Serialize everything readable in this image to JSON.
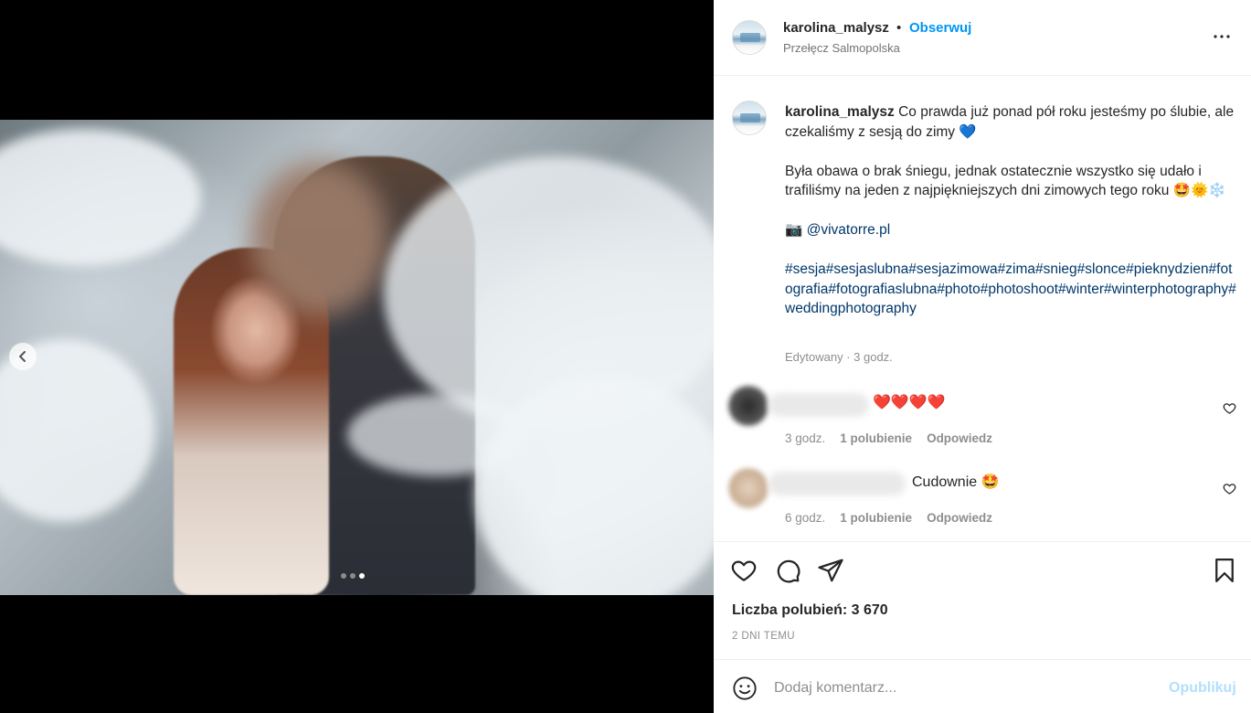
{
  "post": {
    "author": "karolina_malysz",
    "separator": "•",
    "follow_label": "Obserwuj",
    "location": "Przełęcz Salmopolska",
    "more_icon": "more-horizontal-icon"
  },
  "media": {
    "carousel_total": 3,
    "carousel_active": 3
  },
  "caption": {
    "author": "karolina_malysz",
    "line1": "Co prawda już ponad pół roku jesteśmy po ślubie, ale czekaliśmy z sesją do zimy 💙",
    "line2": "Była obawa o brak śniegu, jednak ostatecznie wszystko się udało i trafiliśmy na jeden z najpiękniejszych dni zimowych tego roku 🤩🌞❄️",
    "camera": "📷",
    "mention": "@vivatorre.pl",
    "hashtags": "#sesja#sesjaslubna#sesjazimowa#zima#snieg#slonce#pieknydzien#fotografia#fotografiaslubna#photo#photoshoot#winter#winterphotography#weddingphotography",
    "meta": "Edytowany · 3 godz."
  },
  "comments": [
    {
      "text": "❤️❤️❤️❤️",
      "time": "3 godz.",
      "likes": "1 polubienie",
      "reply": "Odpowiedz"
    },
    {
      "text": "Cudownie 🤩",
      "time": "6 godz.",
      "likes": "1 polubienie",
      "reply": "Odpowiedz"
    }
  ],
  "actions": {
    "likes_text": "Liczba polubień: 3 670",
    "date_text": "2 DNI TEMU"
  },
  "composer": {
    "placeholder": "Dodaj komentarz...",
    "publish_label": "Opublikuj"
  },
  "colors": {
    "accent": "#0095f6",
    "link": "#00376b",
    "muted": "#8e8e8e",
    "publish_disabled": "#b2dffc"
  }
}
